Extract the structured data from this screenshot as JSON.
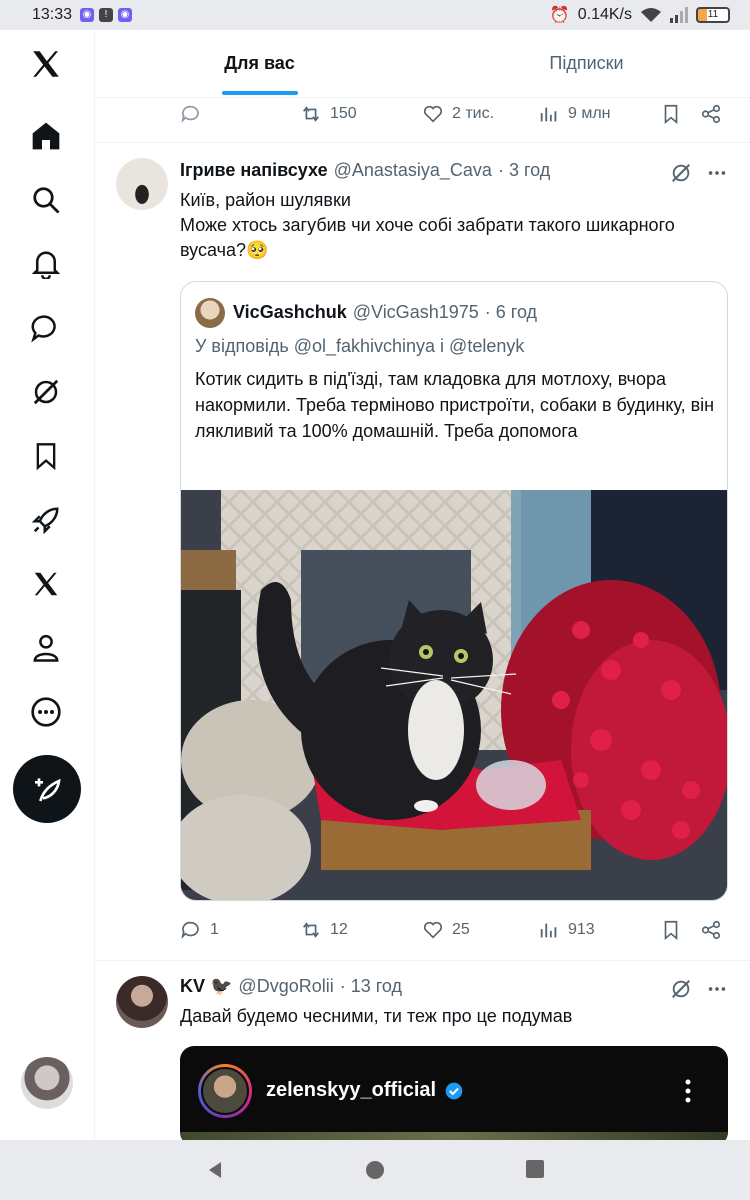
{
  "status_bar": {
    "time": "13:33",
    "network_speed": "0.14K/s",
    "battery": "11"
  },
  "tabs": [
    {
      "label": "Для вас",
      "active": true
    },
    {
      "label": "Підписки",
      "active": false
    }
  ],
  "prev_post_actions": {
    "retweets": "150",
    "likes": "2 тис.",
    "views": "9 млн"
  },
  "post1": {
    "author_name": "Ігриве напівсухе",
    "handle": "@Anastasiya_Cava",
    "time": "· 3 год",
    "text_line1": "Київ, район шулявки",
    "text_line2": "Може хтось загубив чи хоче собі забрати такого шикарного вусача?🥺",
    "quote": {
      "author_name": "VicGashchuk",
      "handle": "@VicGash1975",
      "time": "· 6 год",
      "reply_to": "У відповідь @ol_fakhivchinya і @telenyk",
      "text": "Котик сидить в під'їзді, там кладовка для мотлоху, вчора накормили. Треба терміново пристроїти, собаки в будинку, він лякливий та 100% домашній. Треба допомога"
    },
    "actions": {
      "replies": "1",
      "retweets": "12",
      "likes": "25",
      "views": "913"
    }
  },
  "post2": {
    "author_name": "KV 🐦‍⬛",
    "handle": "@DvgoRolii",
    "time": "· 13 год",
    "text": "Давай будемо чесними, ти теж про це подумав",
    "embed_username": "zelenskyy_official"
  },
  "colors": {
    "accent": "#1d9bf0",
    "text": "#0f1419",
    "muted": "#536471",
    "verified": "#1d9bf0"
  }
}
